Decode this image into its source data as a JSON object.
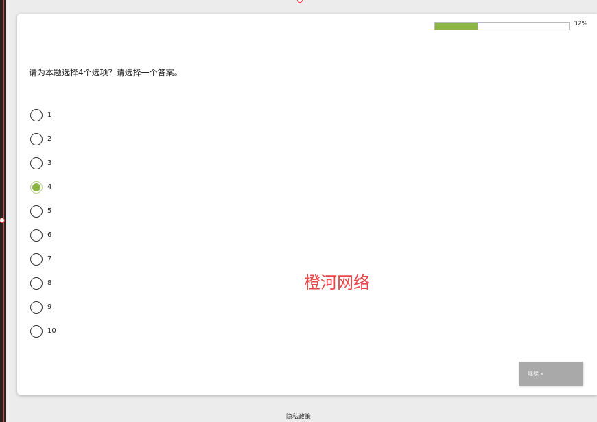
{
  "progress": {
    "percent_label": "32%",
    "fraction": 0.32
  },
  "question": {
    "text": "请为本题选择4个选项？请选择一个答案。"
  },
  "options": [
    {
      "label": "1",
      "selected": false
    },
    {
      "label": "2",
      "selected": false
    },
    {
      "label": "3",
      "selected": false
    },
    {
      "label": "4",
      "selected": true
    },
    {
      "label": "5",
      "selected": false
    },
    {
      "label": "6",
      "selected": false
    },
    {
      "label": "7",
      "selected": false
    },
    {
      "label": "8",
      "selected": false
    },
    {
      "label": "9",
      "selected": false
    },
    {
      "label": "10",
      "selected": false
    }
  ],
  "watermark": {
    "text": "橙河网络"
  },
  "buttons": {
    "continue_label": "继续 »"
  },
  "footer": {
    "privacy_label": "隐私政策"
  },
  "colors": {
    "accent": "#8db543",
    "watermark": "#e8474a",
    "button": "#a9a9a9"
  }
}
